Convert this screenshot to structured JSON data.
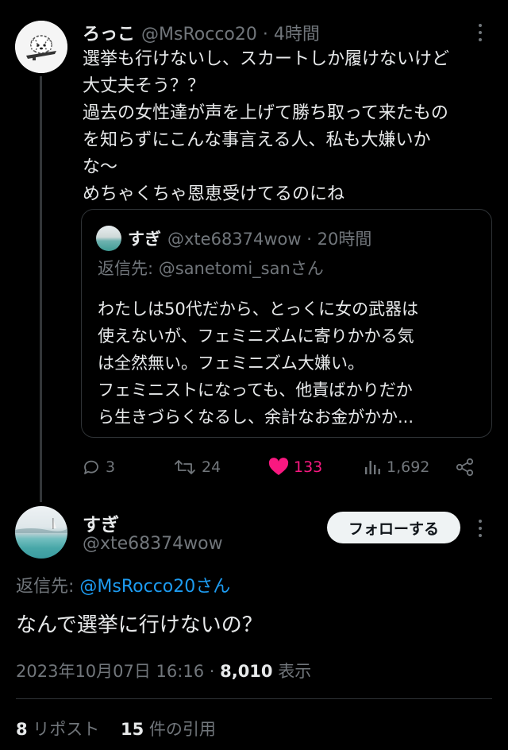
{
  "tweet1": {
    "name": "ろっこ",
    "handle": "@MsRocco20",
    "time": "4時間",
    "lines": [
      "選挙も行けないし、スカートしか履けないけど",
      "大丈夫そう？？",
      "過去の女性達が声を上げて勝ち取って来たもの",
      "を知らずにこんな事言える人、私も大嫌いか",
      "な〜",
      "めちゃくちゃ恩恵受けてるのにね"
    ],
    "quote": {
      "name": "すぎ",
      "handle": "@xte68374wow",
      "time": "20時間",
      "reply_label": "返信先: @sanetomi_sanさん",
      "lines": [
        "わたしは50代だから、とっくに女の武器は",
        "使えないが、フェミニズムに寄りかかる気",
        "は全然無い。フェミニズム大嫌い。",
        "フェミニストになっても、他責ばかりだか",
        "ら生きづらくなるし、余計なお金がかか..."
      ]
    },
    "actions": {
      "replies": "3",
      "reposts": "24",
      "likes": "133",
      "views": "1,692"
    }
  },
  "tweet2": {
    "name": "すぎ",
    "handle": "@xte68374wow",
    "follow_label": "フォローする",
    "reply_prefix": "返信先: ",
    "reply_mention": "@MsRocco20さん",
    "text": "なんで選挙に行けないの？",
    "timestamp": "2023年10月07日 16:16 · ",
    "views_count": "8,010",
    "views_label": " 表示",
    "reposts_count": "8",
    "reposts_label": " リポスト",
    "quotes_count": "15",
    "quotes_label": " 件の引用"
  },
  "colors": {
    "background": "#000000",
    "text": "#e7e9ea",
    "muted": "#71767b",
    "link": "#1d9bf0",
    "like": "#f91880"
  }
}
